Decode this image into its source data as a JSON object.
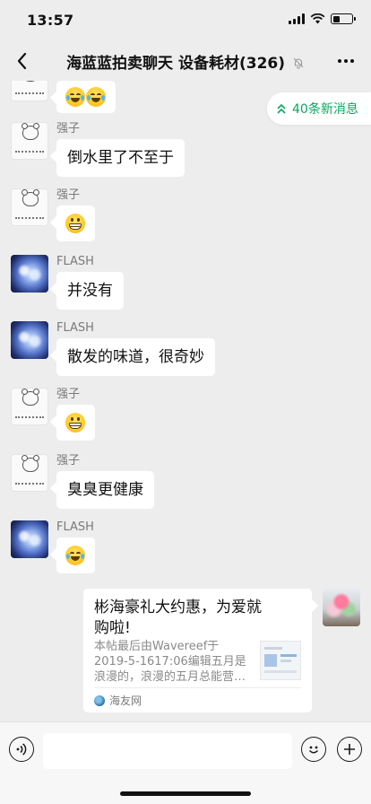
{
  "status_bar": {
    "time": "13:57"
  },
  "nav": {
    "title": "海蓝蓝拍卖聊天  设备耗材(326)"
  },
  "new_messages": {
    "label": "40条新消息"
  },
  "messages": [
    {
      "sender": "",
      "kind": "emoji",
      "emojis": [
        "laugh-cry",
        "laugh-cry"
      ],
      "avatar": "bear"
    },
    {
      "sender": "强子",
      "kind": "text",
      "text": "倒水里了不至于",
      "avatar": "bear"
    },
    {
      "sender": "强子",
      "kind": "emoji",
      "emojis": [
        "grin"
      ],
      "avatar": "bear"
    },
    {
      "sender": "FLASH",
      "kind": "text",
      "text": "并没有",
      "avatar": "flash"
    },
    {
      "sender": "FLASH",
      "kind": "text",
      "text": "散发的味道，很奇妙",
      "avatar": "flash"
    },
    {
      "sender": "强子",
      "kind": "emoji",
      "emojis": [
        "grin"
      ],
      "avatar": "bear"
    },
    {
      "sender": "强子",
      "kind": "text",
      "text": "臭臭更健康",
      "avatar": "bear"
    },
    {
      "sender": "FLASH",
      "kind": "emoji",
      "emojis": [
        "laugh-cry"
      ],
      "avatar": "flash"
    }
  ],
  "link_card": {
    "title_line1": "彬海豪礼大约惠，为爱就",
    "title_line2": "购啦!",
    "desc_line1": "本帖最后由Wavereef于",
    "desc_line2": "2019-5-1617:06编辑五月是",
    "desc_line3": "浪漫的，浪漫的五月总能营…",
    "source": "海友网"
  },
  "input": {
    "placeholder": ""
  },
  "icons": {
    "back": "chevron-left-icon",
    "mute": "bell-off-icon",
    "more": "more-dots-icon",
    "new_msg_arrow": "double-chevron-up-icon",
    "voice": "voice-icon",
    "emoji": "emoji-icon",
    "plus": "plus-icon"
  },
  "colors": {
    "accent": "#07a85f",
    "background": "#ededed",
    "bubble": "#ffffff"
  }
}
